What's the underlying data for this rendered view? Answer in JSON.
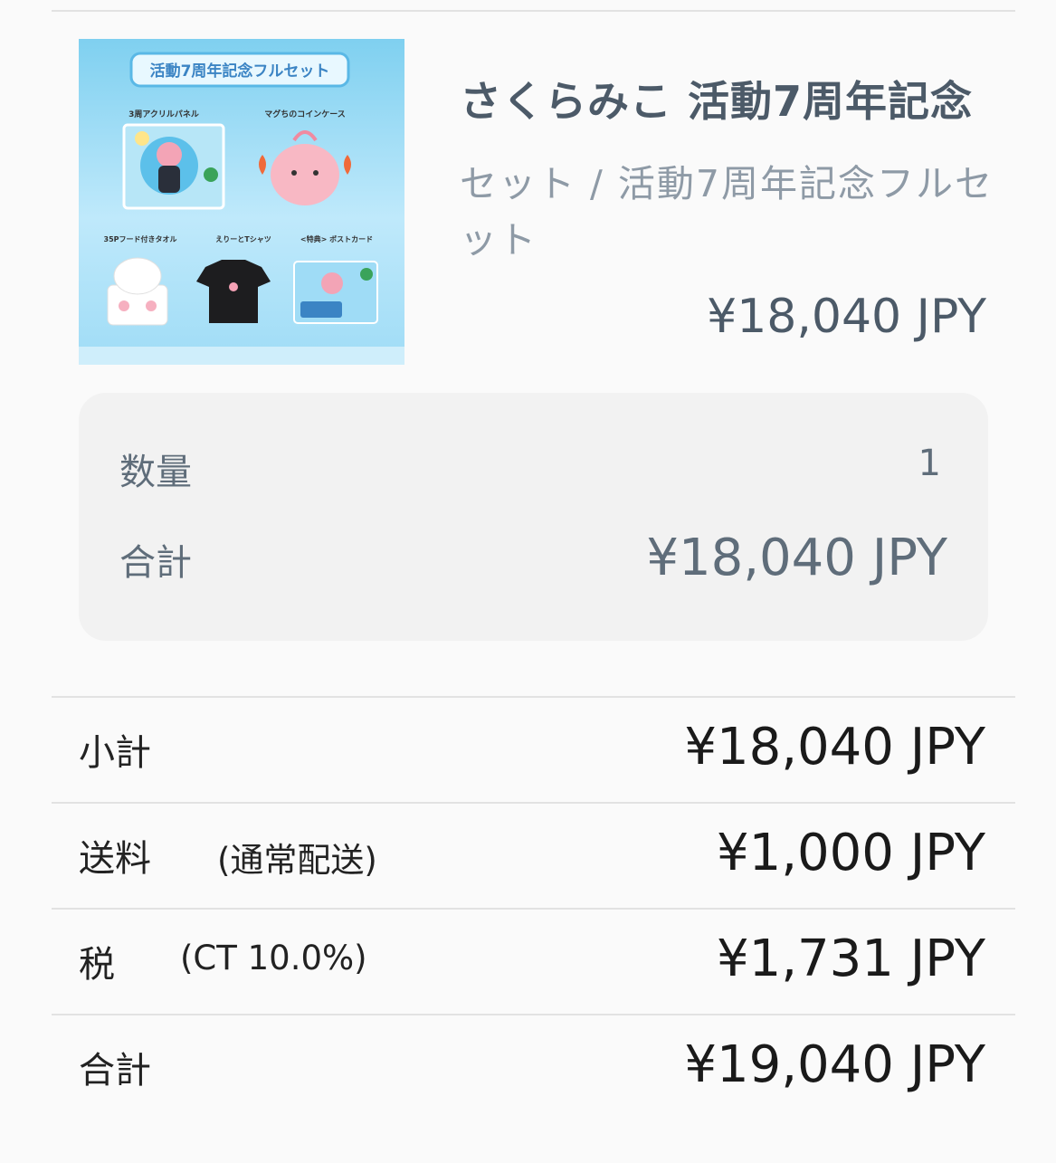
{
  "product": {
    "image_alt_text": "活動7周年記念フルセット",
    "image_labels": {
      "banner": "活動7周年記念フルセット",
      "item1": "3周アクリルパネル",
      "item2": "マグちのコインケース",
      "item3": "35Pフード付きタオル",
      "item4": "えりーとTシャツ",
      "item5": "<特典> ポストカード"
    },
    "title": "さくらみこ 活動7周年記念",
    "variant": "セット / 活動7周年記念フルセット",
    "price": "¥18,040 JPY"
  },
  "line_item": {
    "quantity_label": "数量",
    "quantity_value": "1",
    "total_label": "合計",
    "total_value": "¥18,040 JPY"
  },
  "summary": {
    "subtotal_label": "小計",
    "subtotal_value": "¥18,040 JPY",
    "shipping_label": "送料",
    "shipping_note": "(通常配送)",
    "shipping_value": "¥1,000 JPY",
    "tax_label": "税",
    "tax_note": "(CT 10.0%)",
    "tax_value": "¥1,731 JPY",
    "total_label": "合計",
    "total_value": "¥19,040 JPY"
  },
  "colors": {
    "title_text": "#4c5a68",
    "muted_text": "#8e9aa6",
    "card_bg": "#f2f2f2",
    "divider": "#e2e2e2"
  }
}
